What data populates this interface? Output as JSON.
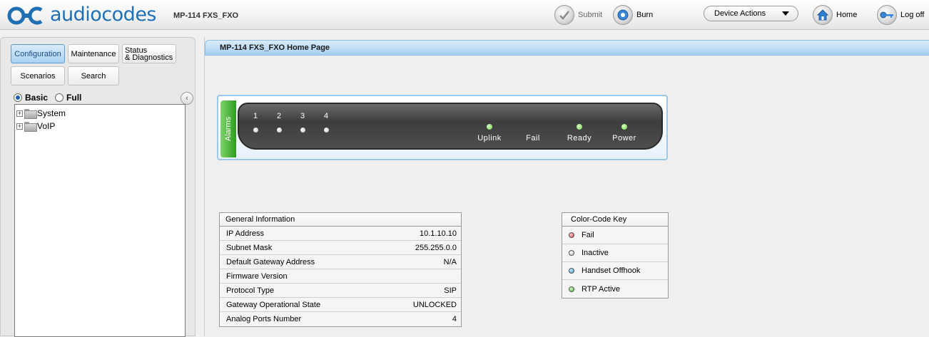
{
  "header": {
    "logo_text": "audiocodes",
    "model": "MP-114 FXS_FXO",
    "submit_label": "Submit",
    "burn_label": "Burn",
    "device_actions_label": "Device Actions",
    "home_label": "Home",
    "logoff_label": "Log off",
    "icons": {
      "submit": "check-icon",
      "burn": "burn-disc-icon",
      "home": "house-icon",
      "logoff": "key-icon"
    }
  },
  "sidebar": {
    "tabs": {
      "configuration": "Configuration",
      "maintenance": "Maintenance",
      "status_line1": "Status",
      "status_line2": "& Diagnostics",
      "scenarios": "Scenarios",
      "search": "Search"
    },
    "active_tab": "Configuration",
    "mode": {
      "basic": "Basic",
      "full": "Full",
      "selected": "Basic"
    },
    "tree": [
      "System",
      "VoIP"
    ]
  },
  "main": {
    "title": "MP-114 FXS_FXO Home Page",
    "device": {
      "alarms_label": "Alarms",
      "ports": [
        "1",
        "2",
        "3",
        "4"
      ],
      "status": [
        {
          "label": "Uplink",
          "color": "#6fd24a"
        },
        {
          "label": "Fail",
          "color": "none"
        },
        {
          "label": "Ready",
          "color": "#6fd24a"
        },
        {
          "label": "Power",
          "color": "#6fd24a"
        }
      ]
    },
    "general_info": {
      "title": "General Information",
      "rows": [
        {
          "label": "IP Address",
          "value": "10.1.10.10"
        },
        {
          "label": "Subnet Mask",
          "value": "255.255.0.0"
        },
        {
          "label": "Default Gateway Address",
          "value": "N/A"
        },
        {
          "label": "Firmware Version",
          "value": ""
        },
        {
          "label": "Protocol Type",
          "value": "SIP"
        },
        {
          "label": "Gateway Operational State",
          "value": "UNLOCKED"
        },
        {
          "label": "Analog Ports Number",
          "value": "4"
        }
      ]
    },
    "color_key": {
      "title": "Color-Code Key",
      "items": [
        {
          "label": "Fail",
          "color": "#e23b3b"
        },
        {
          "label": "Inactive",
          "color": "#b7b7b7"
        },
        {
          "label": "Handset Offhook",
          "color": "#2e9ad6"
        },
        {
          "label": "RTP Active",
          "color": "#4cc23a"
        }
      ]
    }
  }
}
